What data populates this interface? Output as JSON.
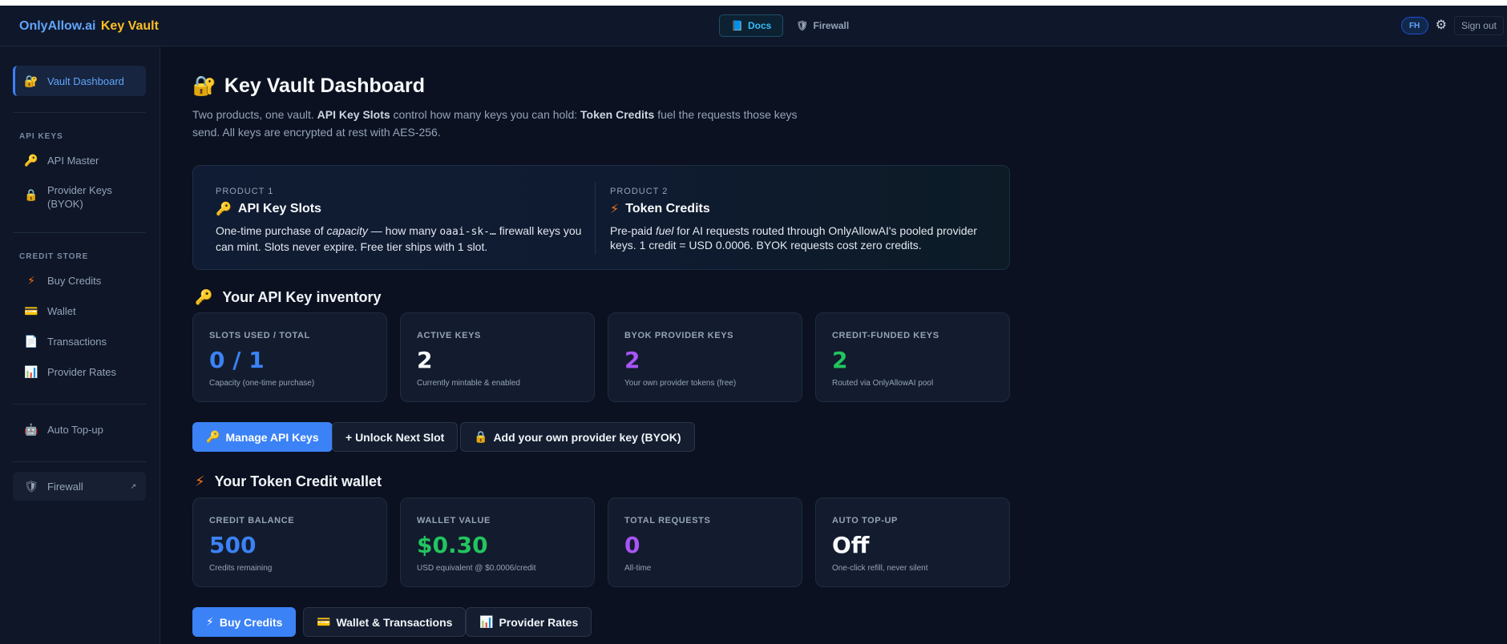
{
  "header": {
    "brand_main": "OnlyAllow.ai",
    "brand_sub": "Key Vault",
    "docs_label": "Docs",
    "firewall_label": "Firewall",
    "avatar_initials": "FH",
    "signout_label": "Sign out"
  },
  "sidebar": {
    "active_item": "Vault Dashboard",
    "sections": [
      {
        "title": "API KEYS",
        "items": [
          "API Master",
          "Provider Keys (BYOK)"
        ]
      },
      {
        "title": "CREDIT STORE",
        "items": [
          "Buy Credits",
          "Wallet",
          "Transactions",
          "Provider Rates"
        ]
      }
    ],
    "auto_topup": "Auto Top-up",
    "firewall": "Firewall"
  },
  "page": {
    "title": "Key Vault Dashboard",
    "subtitle": {
      "p1": "Two products, one vault. ",
      "b1": "API Key Slots",
      "p2": " control how many keys you can hold: ",
      "b2": "Token Credits",
      "p3": " fuel the requests those keys send. All keys are encrypted at rest with AES-256."
    }
  },
  "products": [
    {
      "label": "PRODUCT 1",
      "name": "API Key Slots",
      "desc_pre": "One-time purchase of ",
      "desc_em": "capacity",
      "desc_mid": " — how many ",
      "desc_code": "oaai-sk-…",
      "desc_post": " firewall keys you can mint. Slots never expire. Free tier ships with 1 slot."
    },
    {
      "label": "PRODUCT 2",
      "name": "Token Credits",
      "desc_pre": "Pre-paid ",
      "desc_em": "fuel",
      "desc_post": " for AI requests routed through OnlyAllowAI's pooled provider keys. 1 credit = USD 0.0006. BYOK requests cost zero credits."
    }
  ],
  "inventory": {
    "title": "Your API Key inventory",
    "cards": [
      {
        "label": "SLOTS USED / TOTAL",
        "value": "0 / 1",
        "note": "Capacity (one-time purchase)"
      },
      {
        "label": "ACTIVE KEYS",
        "value": "2",
        "note": "Currently mintable & enabled"
      },
      {
        "label": "BYOK PROVIDER KEYS",
        "value": "2",
        "note": "Your own provider tokens (free)"
      },
      {
        "label": "CREDIT-FUNDED KEYS",
        "value": "2",
        "note": "Routed via OnlyAllowAI pool"
      }
    ],
    "buttons": [
      "Manage API Keys",
      "+ Unlock Next Slot",
      "Add your own provider key (BYOK)"
    ]
  },
  "wallet": {
    "title": "Your Token Credit wallet",
    "cards": [
      {
        "label": "CREDIT BALANCE",
        "value": "500",
        "note": "Credits remaining"
      },
      {
        "label": "WALLET VALUE",
        "value": "$0.30",
        "note": "USD equivalent @ $0.0006/credit"
      },
      {
        "label": "TOTAL REQUESTS",
        "value": "0",
        "note": "All-time"
      },
      {
        "label": "AUTO TOP-UP",
        "value": "Off",
        "note": "One-click refill, never silent"
      }
    ],
    "buttons": [
      "Buy Credits",
      "Wallet & Transactions",
      "Provider Rates"
    ]
  },
  "colors": {
    "blue": "#3b82f6",
    "purple": "#a855f7",
    "green": "#22c55e",
    "amber": "#fbbf24",
    "white": "#f8fafc"
  }
}
